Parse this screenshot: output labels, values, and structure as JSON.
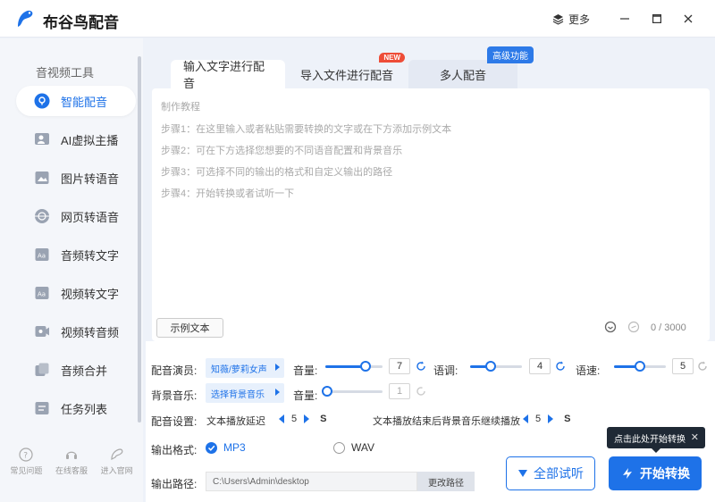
{
  "app": {
    "title": "布谷鸟配音",
    "more": "更多"
  },
  "sidebar": {
    "section_title": "音视频工具",
    "items": [
      {
        "label": "智能配音",
        "icon": "smart-dub-icon"
      },
      {
        "label": "AI虚拟主播",
        "icon": "virtual-anchor-icon"
      },
      {
        "label": "图片转语音",
        "icon": "image-icon"
      },
      {
        "label": "网页转语音",
        "icon": "globe-icon"
      },
      {
        "label": "音频转文字",
        "icon": "audio-text-icon"
      },
      {
        "label": "视频转文字",
        "icon": "video-text-icon"
      },
      {
        "label": "视频转音频",
        "icon": "video-audio-icon"
      },
      {
        "label": "音频合并",
        "icon": "merge-icon"
      },
      {
        "label": "任务列表",
        "icon": "task-list-icon"
      }
    ],
    "bottom": [
      {
        "label": "常见问题",
        "icon": "help-icon"
      },
      {
        "label": "在线客服",
        "icon": "support-icon"
      },
      {
        "label": "进入官网",
        "icon": "website-icon"
      }
    ]
  },
  "tabs": [
    {
      "label": "输入文字进行配音"
    },
    {
      "label": "导入文件进行配音",
      "badge": "NEW"
    },
    {
      "label": "多人配音",
      "badge": "高级功能"
    }
  ],
  "editor": {
    "lines": [
      "制作教程",
      "步骤1：在这里输入或者粘贴需要转换的文字或在下方添加示例文本",
      "步骤2：可在下方选择您想要的不同语音配置和背景音乐",
      "步骤3：可选择不同的输出的格式和自定义输出的路径",
      "步骤4：开始转换或者试听一下"
    ],
    "sample_button": "示例文本",
    "char_count": "0 / 3000"
  },
  "form": {
    "voice_label": "配音演员:",
    "voice_value": "知薇/萝莉女声",
    "volume_label": "音量:",
    "volume_value": "7",
    "volume_fraction": 0.7,
    "tone_label": "语调:",
    "tone_value": "4",
    "tone_fraction": 0.4,
    "speed_label": "语速:",
    "speed_value": "5",
    "speed_fraction": 0.5,
    "bgm_label": "背景音乐:",
    "bgm_value": "选择背景音乐",
    "bgm_volume_label": "音量:",
    "bgm_volume_value": "1",
    "settings_label": "配音设置:",
    "delay_label": "文本播放延迟",
    "delay_value": "5",
    "delay_unit": "S",
    "bg_continue_label": "文本播放结束后背景音乐继续播放",
    "bg_continue_value": "5",
    "bg_continue_unit": "S",
    "format_label": "输出格式:",
    "format_mp3": "MP3",
    "format_wav": "WAV",
    "path_label": "输出路径:",
    "path_value": "C:\\Users\\Admin\\desktop",
    "path_button": "更改路径"
  },
  "actions": {
    "preview": "全部试听",
    "start": "开始转换",
    "tooltip": "点击此处开始转换"
  },
  "colors": {
    "accent": "#1e72e8",
    "badge_new": "#ee4d38"
  }
}
